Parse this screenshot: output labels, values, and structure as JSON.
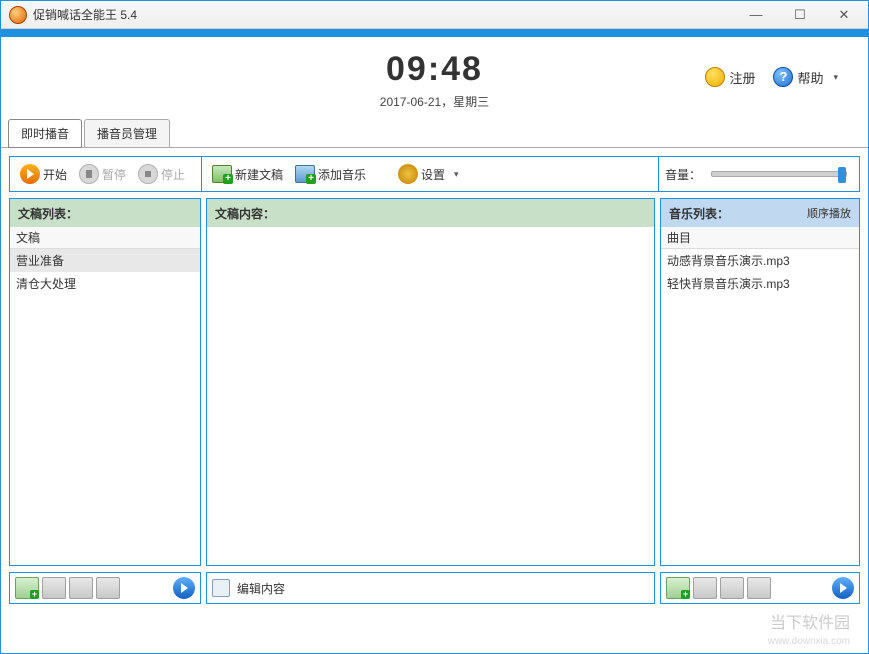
{
  "window": {
    "title": "促销喊话全能王 5.4"
  },
  "header": {
    "time": "09:48",
    "date": "2017-06-21，星期三",
    "register_label": "注册",
    "help_label": "帮助"
  },
  "tabs": {
    "active": "即时播音",
    "other": "播音员管理"
  },
  "toolbar": {
    "start": "开始",
    "pause": "暂停",
    "stop": "停止",
    "new_doc": "新建文稿",
    "add_music": "添加音乐",
    "settings": "设置",
    "volume_label": "音量："
  },
  "columns": {
    "doc_list": {
      "title": "文稿列表：",
      "header": "文稿",
      "items": [
        "营业准备",
        "清仓大处理"
      ]
    },
    "doc_content": {
      "title": "文稿内容："
    },
    "music_list": {
      "title": "音乐列表：",
      "playmode": "顺序播放",
      "header": "曲目",
      "items": [
        "动感背景音乐演示.mp3",
        "轻快背景音乐演示.mp3"
      ]
    }
  },
  "bottom": {
    "edit_content": "编辑内容"
  },
  "watermark": {
    "main": "当下软件园",
    "sub": "www.downxia.com"
  }
}
